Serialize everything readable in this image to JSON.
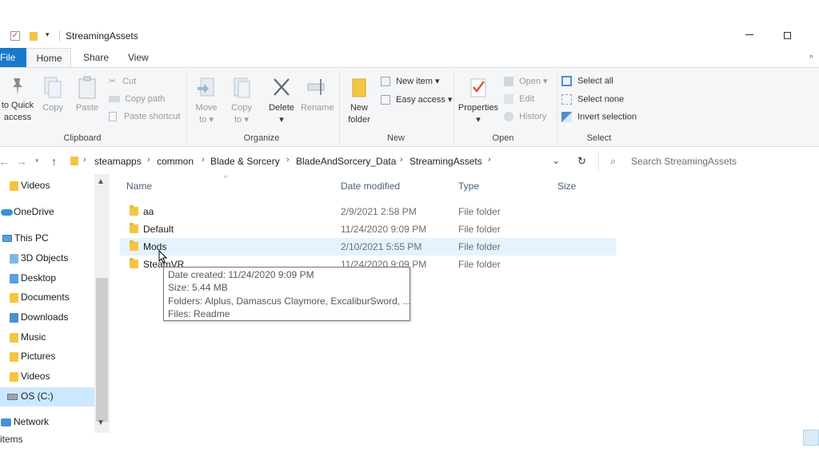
{
  "window": {
    "title": "StreamingAssets"
  },
  "ribbon_tabs": {
    "file": "File",
    "home": "Home",
    "share": "Share",
    "view": "View"
  },
  "ribbon": {
    "clipboard": {
      "pin_line1": "to Quick",
      "pin_line2": "access",
      "copy": "Copy",
      "paste": "Paste",
      "cut": "Cut",
      "copy_path": "Copy path",
      "paste_shortcut": "Paste shortcut",
      "group": "Clipboard"
    },
    "organize": {
      "move_to_line1": "Move",
      "move_to_line2": "to",
      "copy_to_line1": "Copy",
      "copy_to_line2": "to",
      "delete": "Delete",
      "rename": "Rename",
      "group": "Organize"
    },
    "new": {
      "new_folder_line1": "New",
      "new_folder_line2": "folder",
      "new_item": "New item",
      "easy_access": "Easy access",
      "group": "New"
    },
    "open": {
      "properties": "Properties",
      "open": "Open",
      "edit": "Edit",
      "history": "History",
      "group": "Open"
    },
    "select": {
      "select_all": "Select all",
      "select_none": "Select none",
      "invert_selection": "Invert selection",
      "group": "Select"
    }
  },
  "address": {
    "crumbs": [
      "steamapps",
      "common",
      "Blade & Sorcery",
      "BladeAndSorcery_Data",
      "StreamingAssets"
    ],
    "search_placeholder": "Search StreamingAssets"
  },
  "nav": {
    "items": [
      {
        "label": "Videos"
      },
      {
        "label": "OneDrive"
      },
      {
        "label": "This PC"
      },
      {
        "label": "3D Objects"
      },
      {
        "label": "Desktop"
      },
      {
        "label": "Documents"
      },
      {
        "label": "Downloads"
      },
      {
        "label": "Music"
      },
      {
        "label": "Pictures"
      },
      {
        "label": "Videos"
      },
      {
        "label": "OS (C:)"
      },
      {
        "label": "Network"
      }
    ]
  },
  "columns": {
    "name": "Name",
    "date_modified": "Date modified",
    "type": "Type",
    "size": "Size"
  },
  "files": [
    {
      "name": "aa",
      "date": "2/9/2021 2:58 PM",
      "type": "File folder"
    },
    {
      "name": "Default",
      "date": "11/24/2020 9:09 PM",
      "type": "File folder"
    },
    {
      "name": "Mods",
      "date": "2/10/2021 5:55 PM",
      "type": "File folder"
    },
    {
      "name": "SteamVR",
      "date": "11/24/2020 9:09 PM",
      "type": "File folder"
    }
  ],
  "tooltip": {
    "date_created": "Date created: 11/24/2020 9:09 PM",
    "size": "Size: 5.44 MB",
    "folders": "Folders: Alplus, Damascus Claymore, ExcaliburSword, ...",
    "files": "Files: Readme"
  },
  "status": {
    "text": "items"
  },
  "colors": {
    "file_tab": "#1979ca",
    "selection": "#cce8ff",
    "hover_row": "#e5f3ff",
    "folder": "#f4c542"
  }
}
